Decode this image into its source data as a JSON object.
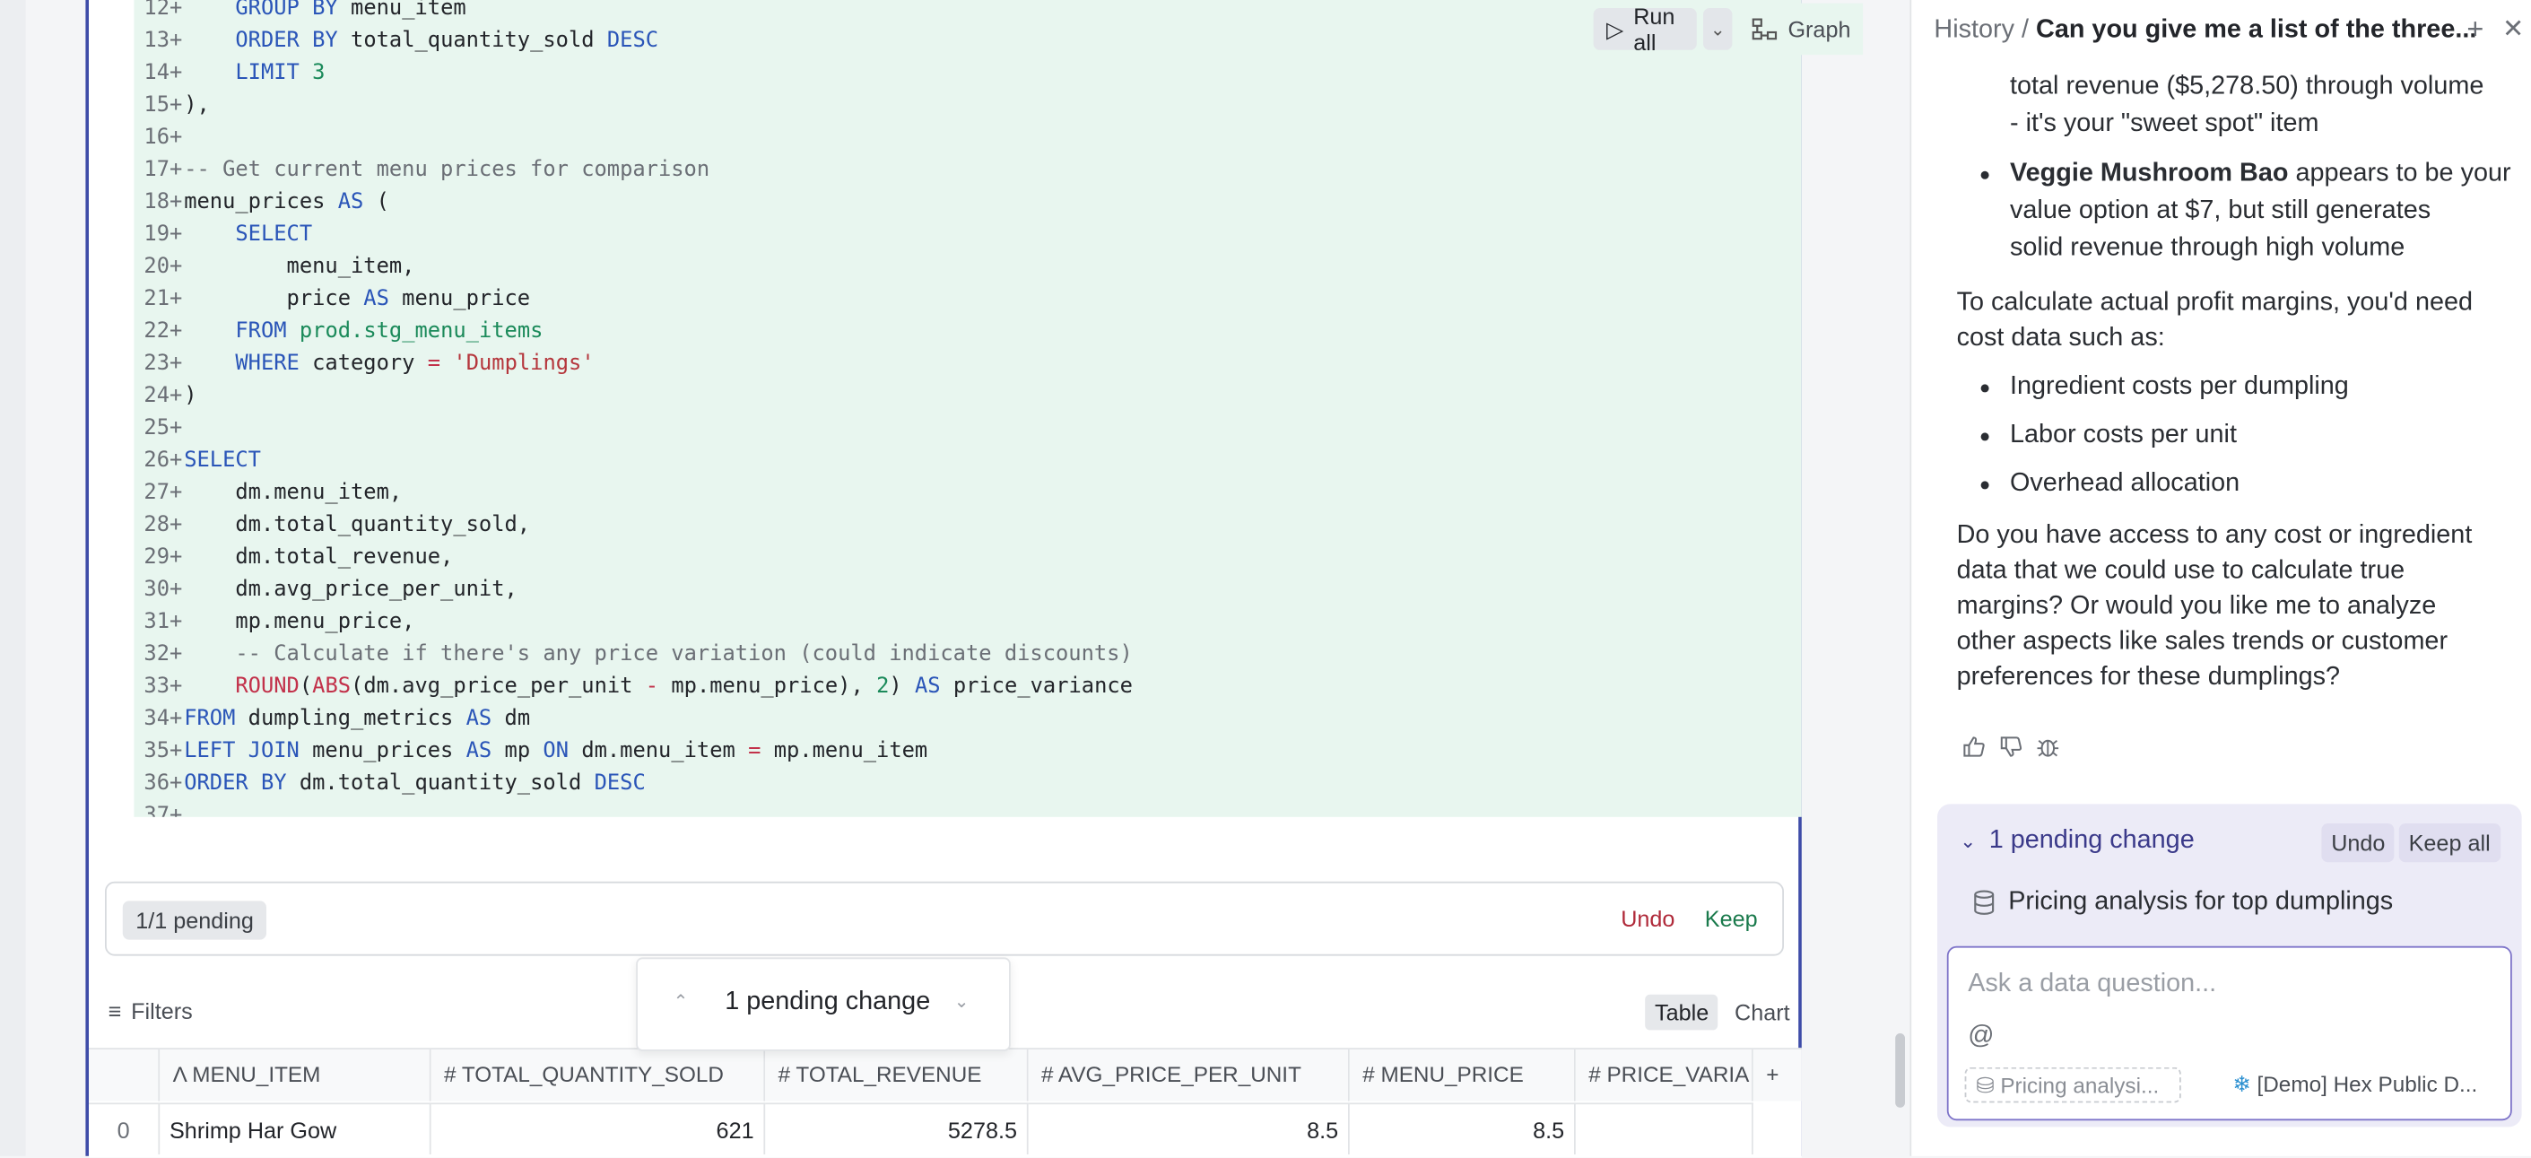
{
  "code": {
    "lines": [
      {
        "n": "12",
        "html": "    <span class=\"kw\">GROUP BY</span> menu_item"
      },
      {
        "n": "13",
        "html": "    <span class=\"kw\">ORDER BY</span> total_quantity_sold <span class=\"kw\">DESC</span>"
      },
      {
        "n": "14",
        "html": "    <span class=\"kw\">LIMIT</span> <span class=\"num\">3</span>"
      },
      {
        "n": "15",
        "html": "),"
      },
      {
        "n": "16",
        "html": ""
      },
      {
        "n": "17",
        "html": "<span class=\"cm\">-- Get current menu prices for comparison</span>"
      },
      {
        "n": "18",
        "html": "menu_prices <span class=\"kw\">AS</span> ("
      },
      {
        "n": "19",
        "html": "    <span class=\"kw\">SELECT</span>"
      },
      {
        "n": "20",
        "html": "        menu_item,"
      },
      {
        "n": "21",
        "html": "        price <span class=\"kw\">AS</span> menu_price"
      },
      {
        "n": "22",
        "html": "    <span class=\"kw\">FROM</span> <span class=\"tbl\">prod.stg_menu_items</span>"
      },
      {
        "n": "23",
        "html": "    <span class=\"kw\">WHERE</span> category <span class=\"op\">=</span> <span class=\"str\">'Dumplings'</span>"
      },
      {
        "n": "24",
        "html": ")"
      },
      {
        "n": "25",
        "html": ""
      },
      {
        "n": "26",
        "html": "<span class=\"kw\">SELECT</span>"
      },
      {
        "n": "27",
        "html": "    dm.menu_item,"
      },
      {
        "n": "28",
        "html": "    dm.total_quantity_sold,"
      },
      {
        "n": "29",
        "html": "    dm.total_revenue,"
      },
      {
        "n": "30",
        "html": "    dm.avg_price_per_unit,"
      },
      {
        "n": "31",
        "html": "    mp.menu_price,"
      },
      {
        "n": "32",
        "html": "    <span class=\"cm\">-- Calculate if there's any price variation (could indicate discounts)</span>"
      },
      {
        "n": "33",
        "html": "    <span class=\"fn\">ROUND</span>(<span class=\"fn\">ABS</span>(dm.avg_price_per_unit <span class=\"op\">-</span> mp.menu_price), <span class=\"num\">2</span>) <span class=\"kw\">AS</span> price_variance"
      },
      {
        "n": "34",
        "html": "<span class=\"kw\">FROM</span> dumpling_metrics <span class=\"kw\">AS</span> dm"
      },
      {
        "n": "35",
        "html": "<span class=\"kw\">LEFT JOIN</span> menu_prices <span class=\"kw\">AS</span> mp <span class=\"kw\">ON</span> dm.menu_item <span class=\"op\">=</span> mp.menu_item"
      },
      {
        "n": "36",
        "html": "<span class=\"kw\">ORDER BY</span> dm.total_quantity_sold <span class=\"kw\">DESC</span>"
      },
      {
        "n": "37",
        "html": ""
      }
    ]
  },
  "toolbar": {
    "run_all": "Run all",
    "graph": "Graph"
  },
  "pending_bar": {
    "tag": "1/1 pending",
    "undo": "Undo",
    "keep": "Keep"
  },
  "float": {
    "label": "1 pending change"
  },
  "results": {
    "filters": "Filters",
    "view_table": "Table",
    "view_chart": "Chart",
    "columns": [
      "MENU_ITEM",
      "TOTAL_QUANTITY_SOLD",
      "TOTAL_REVENUE",
      "AVG_PRICE_PER_UNIT",
      "MENU_PRICE",
      "PRICE_VARIA"
    ],
    "row": {
      "index": "0",
      "menu_item": "Shrimp Har Gow",
      "qty": "621",
      "revenue": "5278.5",
      "avg": "8.5",
      "price": "8.5"
    }
  },
  "panel": {
    "history": "History /",
    "title": "Can you give me a list of the three...",
    "para0a": "total revenue ($5,278.50) through volume",
    "para0b": "- it's your \"sweet spot\" item",
    "bullet_bold": "Veggie Mushroom Bao",
    "bullet_rest1": " appears to be your",
    "bullet_rest2": "value option at $7, but still generates",
    "bullet_rest3": "solid revenue through high volume",
    "para1a": "To calculate actual profit margins, you'd need",
    "para1b": "cost data such as:",
    "list": [
      "Ingredient costs per dumpling",
      "Labor costs per unit",
      "Overhead allocation"
    ],
    "para2": [
      "Do you have access to any cost or ingredient",
      "data that we could use to calculate true",
      "margins? Or would you like me to analyze",
      "other aspects like sales trends or customer",
      "preferences for these dumplings?"
    ],
    "pending_head": "1 pending change",
    "pending_undo": "Undo",
    "pending_keep": "Keep all",
    "pending_item": "Pricing analysis for top dumplings",
    "ask_placeholder": "Ask a data question...",
    "ask_at": "@",
    "chip_cell": "Pricing analysi...",
    "chip_source": "[Demo] Hex Public D..."
  }
}
